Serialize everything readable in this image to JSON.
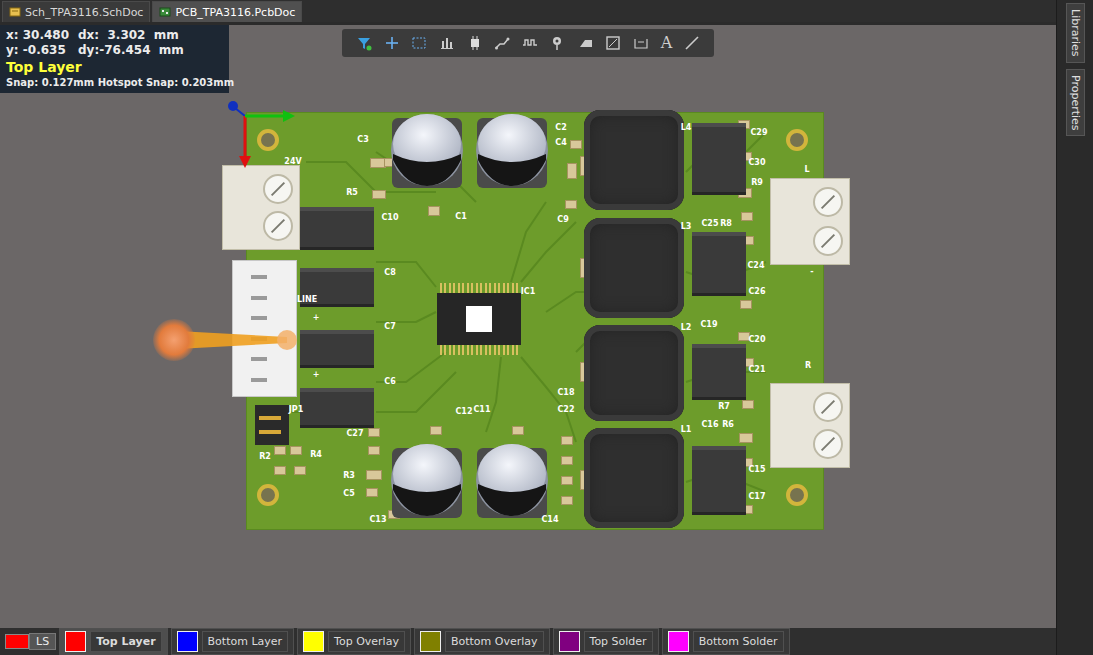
{
  "window": {
    "title": "PCB_TPA3116.PcbDoc"
  },
  "tabs": [
    {
      "label": "Sch_TPA3116.SchDoc",
      "selected": false,
      "kind": "schematic"
    },
    {
      "label": "PCB_TPA3116.PcbDoc",
      "selected": true,
      "kind": "pcb"
    }
  ],
  "side_panels": [
    "Libraries",
    "Properties"
  ],
  "hud": {
    "x": "x: 30.480",
    "dx": "dx:  3.302  mm",
    "y": "y: -0.635",
    "dy": "dy:-76.454  mm",
    "layer": "Top Layer",
    "snap": "Snap: 0.127mm Hotspot Snap: 0.203mm"
  },
  "toolbar": {
    "text_tool": "A"
  },
  "board": {
    "designators": [
      "C3",
      "R5",
      "C10",
      "C1",
      "C2",
      "C4",
      "C9",
      "L4",
      "C29",
      "C30",
      "R9",
      "R8",
      "C25",
      "L3",
      "C24",
      "C26",
      "C8",
      "IC1",
      "24V",
      "LINE",
      "C7",
      "C6",
      "L2",
      "C19",
      "C20",
      "C21",
      "R7",
      "R6",
      "C18",
      "C22",
      "C12",
      "C11",
      "L1",
      "C16",
      "C15",
      "C17",
      "C27",
      "R3",
      "C5",
      "C13",
      "C14",
      "R2",
      "R4",
      "JP1",
      "L",
      "R",
      "+",
      "+",
      "-"
    ]
  },
  "layers": [
    {
      "label": "LS",
      "color": "#ff0000",
      "selected": false,
      "kind": "set"
    },
    {
      "label": "Top Layer",
      "color": "#ff0000",
      "selected": true,
      "kind": "layer"
    },
    {
      "label": "Bottom Layer",
      "color": "#0000ff",
      "selected": false,
      "kind": "layer"
    },
    {
      "label": "Top Overlay",
      "color": "#ffff00",
      "selected": false,
      "kind": "layer"
    },
    {
      "label": "Bottom Overlay",
      "color": "#808000",
      "selected": false,
      "kind": "layer"
    },
    {
      "label": "Top Solder",
      "color": "#800080",
      "selected": false,
      "kind": "layer"
    },
    {
      "label": "Bottom Solder",
      "color": "#ff00ff",
      "selected": false,
      "kind": "layer"
    }
  ]
}
